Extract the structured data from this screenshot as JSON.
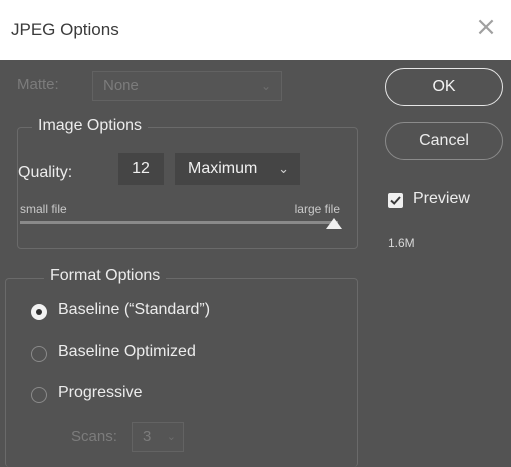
{
  "window": {
    "title": "JPEG Options",
    "close_glyph": "×"
  },
  "matte": {
    "label": "Matte:",
    "value": "None",
    "enabled": false
  },
  "image_options": {
    "title": "Image Options",
    "quality_label": "Quality:",
    "quality_value": "12",
    "quality_preset": "Maximum",
    "small_label": "small file",
    "large_label": "large file",
    "slider_fraction": 1.0
  },
  "format_options": {
    "title": "Format Options",
    "options": [
      "Baseline (“Standard”)",
      "Baseline Optimized",
      "Progressive"
    ],
    "selected_index": 0,
    "scans_label": "Scans:",
    "scans_value": "3",
    "scans_enabled": false
  },
  "buttons": {
    "ok": "OK",
    "cancel": "Cancel"
  },
  "preview": {
    "label": "Preview",
    "checked": true,
    "file_size": "1.6M"
  },
  "icons": {
    "close": "close-icon",
    "chevron": "chevron-down-icon",
    "check": "checkmark-icon"
  }
}
